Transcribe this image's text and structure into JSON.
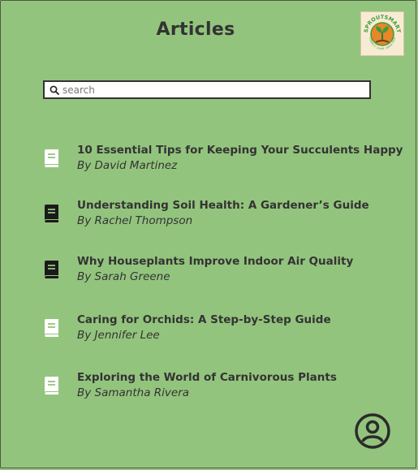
{
  "header": {
    "title": "Articles",
    "logo": {
      "brand_text": "SPROUTSMART",
      "tagline": "CONNECT. SHARE. GROW. FEED"
    }
  },
  "search": {
    "placeholder": "search",
    "value": ""
  },
  "articles": [
    {
      "title": "10 Essential Tips for Keeping Your Succulents Happy",
      "author": "By David Martinez",
      "icon": "book-icon",
      "icon_color": "#ffffff"
    },
    {
      "title": "Understanding Soil Health: A Gardener’s Guide",
      "author": "By Rachel Thompson",
      "icon": "book-icon",
      "icon_color": "#1a1a1a"
    },
    {
      "title": "Why Houseplants Improve Indoor Air Quality",
      "author": "By Sarah Greene",
      "icon": "book-icon",
      "icon_color": "#1a1a1a"
    },
    {
      "title": "Caring for Orchids: A Step-by-Step Guide",
      "author": "By Jennifer Lee",
      "icon": "book-icon",
      "icon_color": "#ffffff"
    },
    {
      "title": "Exploring the World of Carnivorous Plants",
      "author": "By Samantha Rivera",
      "icon": "book-icon",
      "icon_color": "#ffffff"
    }
  ],
  "footer": {
    "profile_icon": "user-profile-icon"
  },
  "colors": {
    "background": "#93c47d",
    "text": "#333333",
    "logo_orange": "#e8862a",
    "logo_green": "#3f9b3a"
  }
}
